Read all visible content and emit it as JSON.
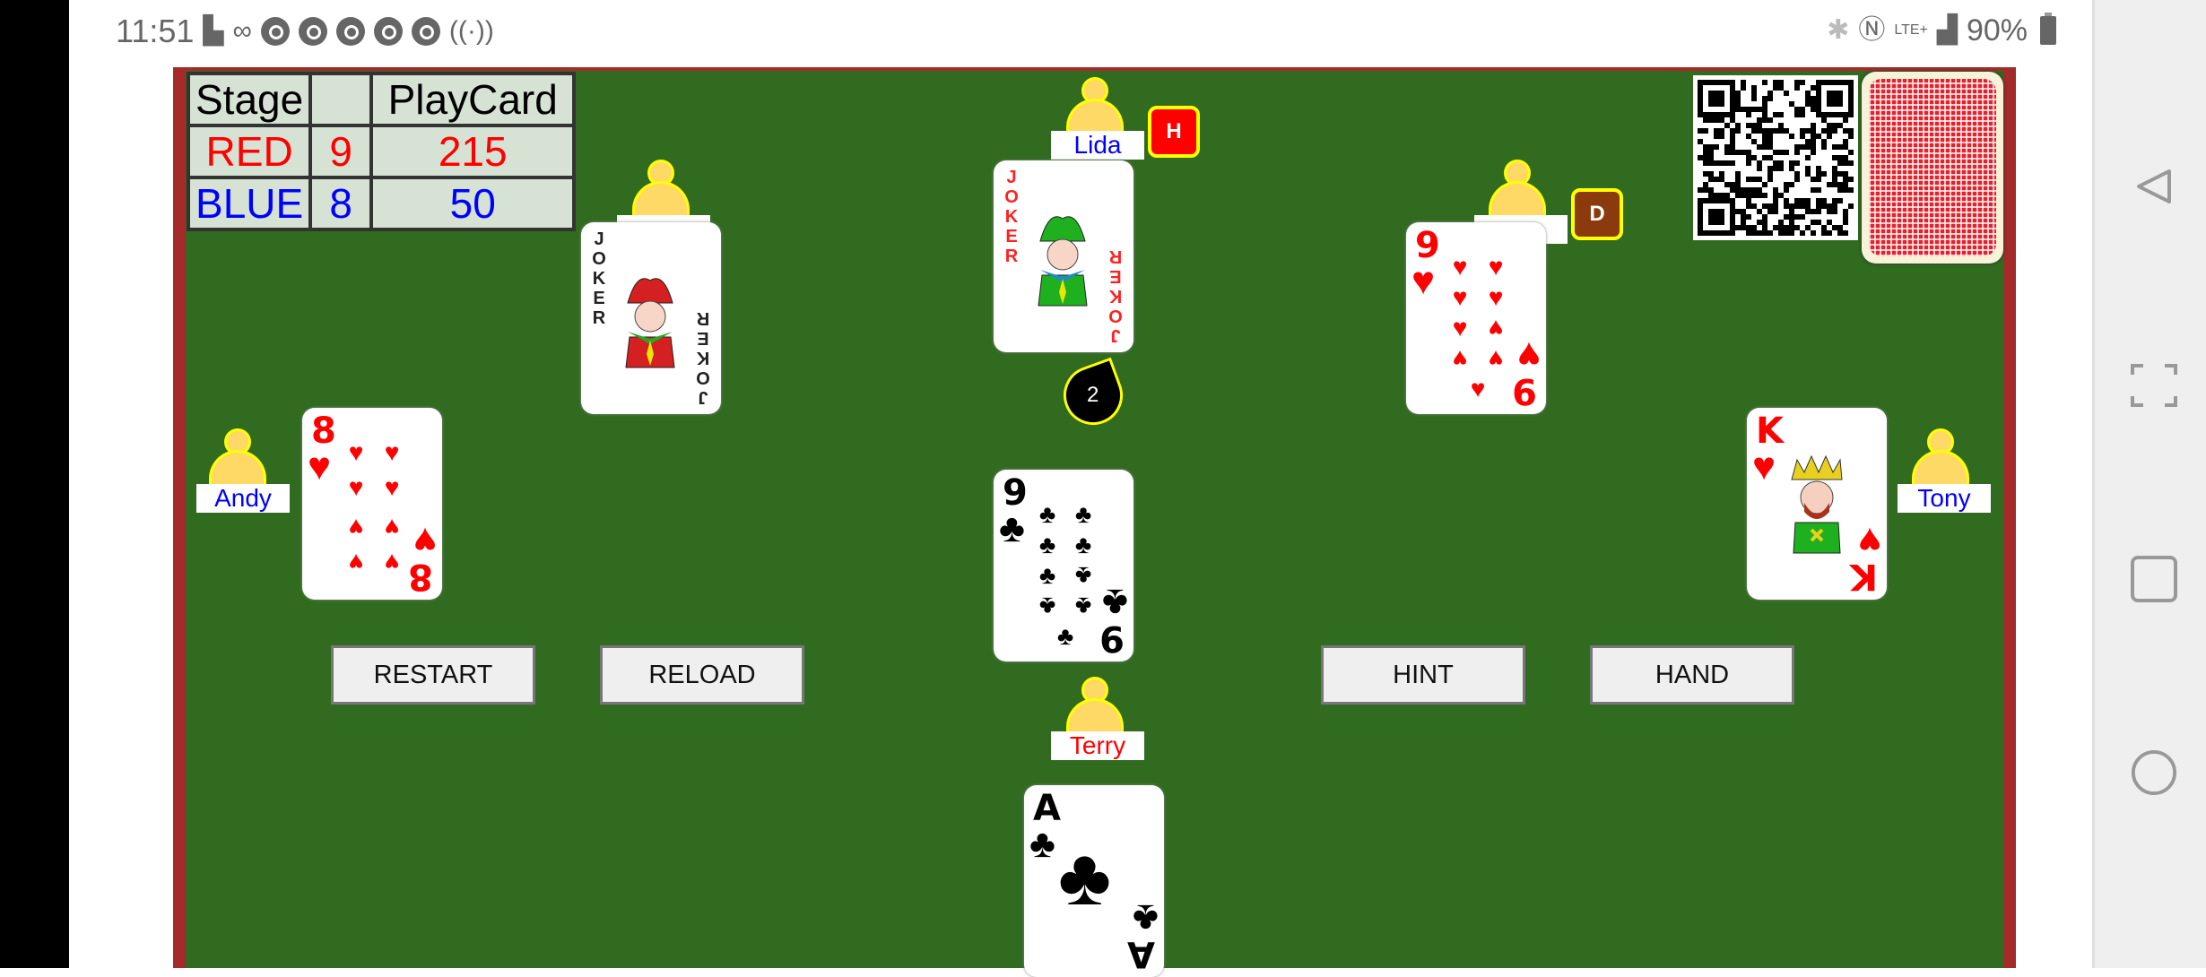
{
  "status_bar": {
    "time": "11:51",
    "left_icons": [
      "video-call-icon",
      "voicemail-icon",
      "chrome-icon",
      "chrome-icon",
      "chrome-icon",
      "chrome-icon",
      "chrome-icon",
      "hotspot-icon"
    ],
    "right_icons": [
      "bluetooth-icon",
      "nfc-icon",
      "lte-plus-icon",
      "signal-icon"
    ],
    "battery_percent": "90%"
  },
  "scoreboard": {
    "header": [
      "Stage",
      "",
      "PlayCard"
    ],
    "rows": [
      {
        "team": "RED",
        "stage": "9",
        "playcard": "215",
        "color": "#ff0000"
      },
      {
        "team": "BLUE",
        "stage": "8",
        "playcard": "50",
        "color": "#0000ff"
      }
    ]
  },
  "players": {
    "top": {
      "name": "Lida",
      "color": "#0000ff",
      "badge": "H",
      "badge_color": "#ff0000"
    },
    "top_left": {
      "name": "",
      "color": "#ff0000"
    },
    "top_right": {
      "name": "",
      "color": "#ff0000",
      "badge": "D",
      "badge_color": "#8b3a0e"
    },
    "left": {
      "name": "Andy",
      "color": "#0000ff"
    },
    "right": {
      "name": "Tony",
      "color": "#0000ff"
    },
    "bottom": {
      "name": "Terry",
      "color": "#ff0000"
    }
  },
  "cards": {
    "top": {
      "rank": "JOKER",
      "suit": "",
      "color": "#ff0000"
    },
    "top_left": {
      "rank": "JOKER",
      "suit": "",
      "color": "#000000"
    },
    "top_right": {
      "rank": "9",
      "suit": "♥",
      "color": "#ff0000"
    },
    "left": {
      "rank": "8",
      "suit": "♥",
      "color": "#ff0000"
    },
    "right": {
      "rank": "K",
      "suit": "♥",
      "color": "#ff0000"
    },
    "center": {
      "rank": "9",
      "suit": "♣",
      "color": "#000000"
    },
    "hand": {
      "rank": "A",
      "suit": "♣",
      "color": "#000000"
    }
  },
  "trick_marker": "2",
  "buttons": {
    "restart": "RESTART",
    "reload": "RELOAD",
    "hint": "HINT",
    "hand": "HAND"
  },
  "colors": {
    "felt": "#306b1f",
    "border": "#a52a2a"
  }
}
